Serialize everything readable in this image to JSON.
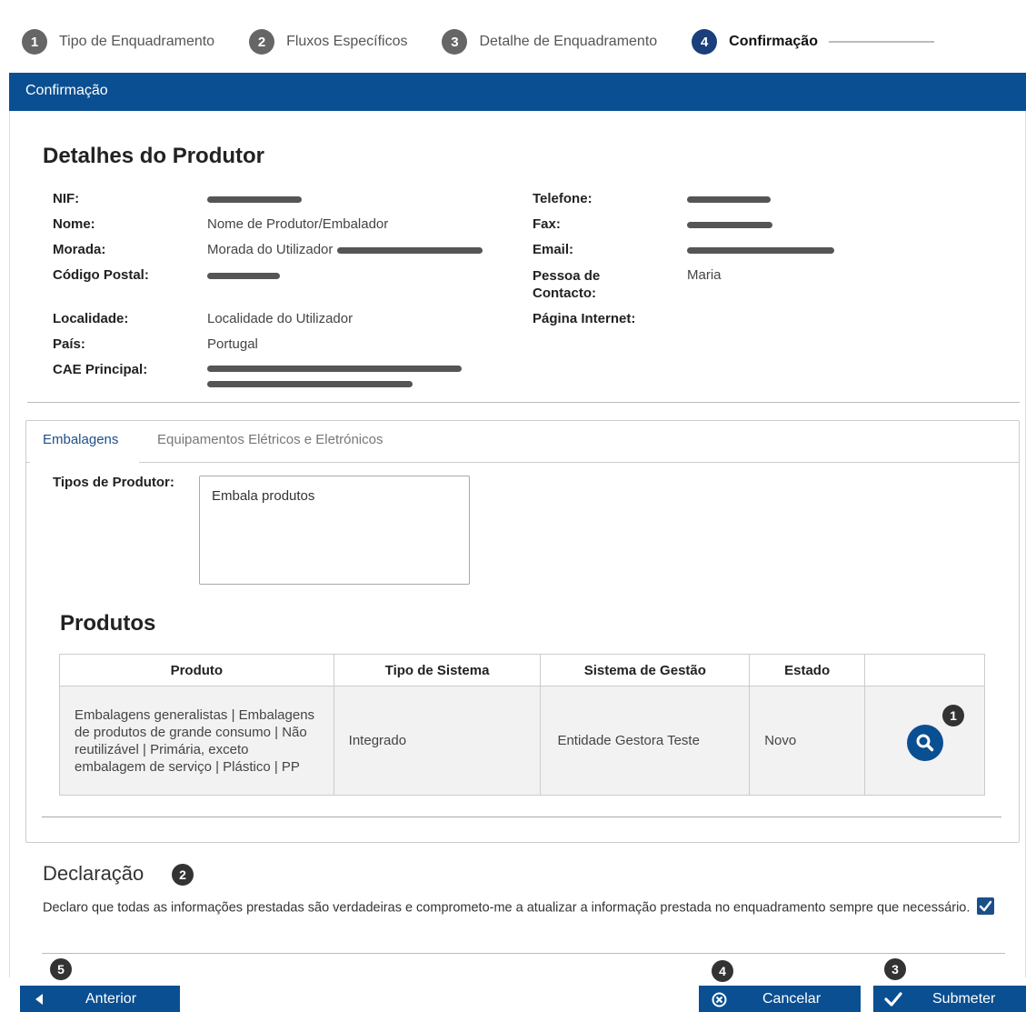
{
  "stepper": {
    "steps": [
      {
        "num": "1",
        "label": "Tipo de Enquadramento"
      },
      {
        "num": "2",
        "label": "Fluxos Específicos"
      },
      {
        "num": "3",
        "label": "Detalhe de Enquadramento"
      },
      {
        "num": "4",
        "label": "Confirmação"
      }
    ]
  },
  "section_title": "Confirmação",
  "produtor": {
    "heading": "Detalhes do Produtor",
    "fields": {
      "nif": {
        "label": "NIF:",
        "value": ""
      },
      "nome": {
        "label": "Nome:",
        "value": "Nome de Produtor/Embalador"
      },
      "morada": {
        "label": "Morada:",
        "value": "Morada do Utilizador"
      },
      "codigo_postal": {
        "label": "Código Postal:",
        "value": ""
      },
      "localidade": {
        "label": "Localidade:",
        "value": "Localidade do Utilizador"
      },
      "pais": {
        "label": "País:",
        "value": "Portugal"
      },
      "cae": {
        "label": "CAE Principal:",
        "value": ""
      },
      "telefone": {
        "label": "Telefone:",
        "value": ""
      },
      "fax": {
        "label": "Fax:",
        "value": ""
      },
      "email": {
        "label": "Email:",
        "value": ""
      },
      "contacto": {
        "label": "Pessoa de Contacto:",
        "value": "Maria"
      },
      "internet": {
        "label": "Página Internet:",
        "value": ""
      }
    }
  },
  "tabs": [
    {
      "label": "Embalagens",
      "active": true
    },
    {
      "label": "Equipamentos Elétricos e Eletrónicos",
      "active": false
    }
  ],
  "tipos": {
    "label": "Tipos de Produtor:",
    "value": "Embala produtos"
  },
  "produtos": {
    "heading": "Produtos",
    "columns": [
      "Produto",
      "Tipo de Sistema",
      "Sistema de Gestão",
      "Estado",
      ""
    ],
    "rows": [
      {
        "produto": "Embalagens generalistas | Embalagens de produtos de grande consumo | Não reutilizável | Primária, exceto embalagem de serviço | Plástico | PP",
        "tipo_sistema": "Integrado",
        "sistema_gestao": "Entidade Gestora Teste",
        "estado": "Novo"
      }
    ]
  },
  "declaracao": {
    "heading": "Declaração",
    "text": "Declaro que todas as informações prestadas são verdadeiras e comprometo-me a atualizar a informação prestada no enquadramento sempre que necessário.",
    "checked": true
  },
  "annotations": [
    "1",
    "2",
    "3",
    "4",
    "5"
  ],
  "buttons": {
    "anterior": "Anterior",
    "cancelar": "Cancelar",
    "submeter": "Submeter"
  },
  "colors": {
    "primary": "#0a4f91",
    "step_inactive": "#666666",
    "step_active": "#1b3f7b"
  }
}
